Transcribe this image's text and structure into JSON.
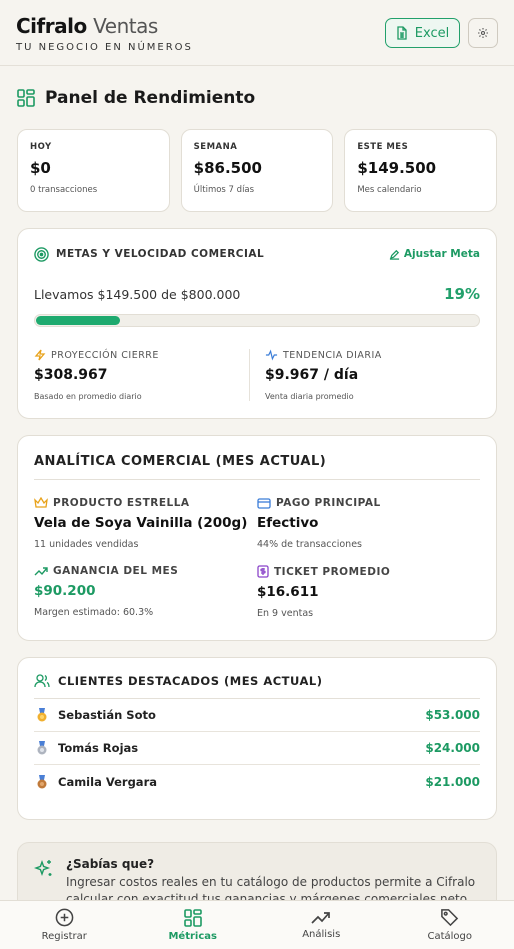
{
  "header": {
    "brand_bold": "Cifralo",
    "brand_light": "Ventas",
    "tagline": "TU NEGOCIO EN NÚMEROS",
    "excel_label": "Excel",
    "settings_icon": "gear-icon"
  },
  "panel": {
    "title": "Panel de Rendimiento",
    "icon": "dashboard-grid-icon"
  },
  "stats": [
    {
      "label": "HOY",
      "value": "$0",
      "sub": "0 transacciones"
    },
    {
      "label": "SEMANA",
      "value": "$86.500",
      "sub": "Últimos 7 días"
    },
    {
      "label": "ESTE MES",
      "value": "$149.500",
      "sub": "Mes calendario"
    }
  ],
  "goals": {
    "title": "METAS Y VELOCIDAD COMERCIAL",
    "adjust_label": "Ajustar Meta",
    "progress_text": "Llevamos $149.500 de $800.000",
    "progress_percent_label": "19%",
    "progress_fraction": 0.19,
    "projection": {
      "label": "PROYECCIÓN CIERRE",
      "value": "$308.967",
      "sub": "Basado en promedio diario"
    },
    "trend": {
      "label": "TENDENCIA DIARIA",
      "value": "$9.967 / día",
      "sub": "Venta diaria promedio"
    }
  },
  "analytics": {
    "title": "ANALÍTICA COMERCIAL (MES ACTUAL)",
    "items": [
      {
        "label": "PRODUCTO ESTRELLA",
        "value": "Vela de Soya Vainilla (200g)",
        "sub": "11 unidades vendidas",
        "icon": "crown-icon"
      },
      {
        "label": "PAGO PRINCIPAL",
        "value": "Efectivo",
        "sub": "44% de transacciones",
        "icon": "credit-card-icon"
      },
      {
        "label": "GANANCIA DEL MES",
        "value": "$90.200",
        "sub": "Margen estimado: 60.3%",
        "icon": "trending-up-icon"
      },
      {
        "label": "TICKET PROMEDIO",
        "value": "$16.611",
        "sub": "En 9 ventas",
        "icon": "receipt-dollar-icon"
      }
    ]
  },
  "clients": {
    "title": "CLIENTES DESTACADOS (MES ACTUAL)",
    "rows": [
      {
        "name": "Sebastián Soto",
        "amount": "$53.000",
        "medal": "gold"
      },
      {
        "name": "Tomás Rojas",
        "amount": "$24.000",
        "medal": "silver"
      },
      {
        "name": "Camila Vergara",
        "amount": "$21.000",
        "medal": "bronze"
      }
    ]
  },
  "tip": {
    "title": "¿Sabías que?",
    "body": "Ingresar costos reales en tu catálogo de productos permite a Cifralo calcular con exactitud tus ganancias y márgenes comerciales neto en"
  },
  "nav": [
    {
      "label": "Registrar",
      "icon": "plus-circle-icon",
      "active": false
    },
    {
      "label": "Métricas",
      "icon": "dashboard-grid-icon",
      "active": true
    },
    {
      "label": "Análisis",
      "icon": "trending-up-icon",
      "active": false
    },
    {
      "label": "Catálogo",
      "icon": "tag-icon",
      "active": false
    }
  ],
  "colors": {
    "accent": "#1d9a63",
    "background": "#f6f4ef",
    "card": "#ffffff"
  }
}
